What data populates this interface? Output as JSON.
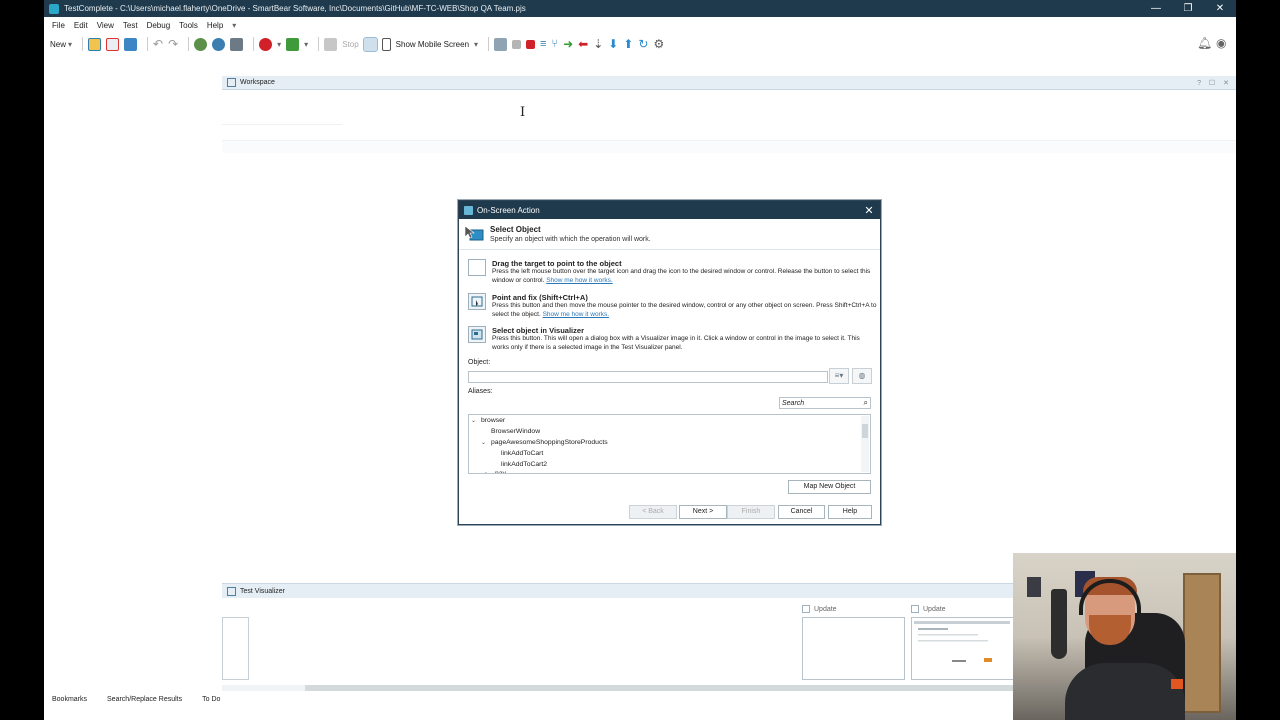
{
  "window": {
    "title": "TestComplete - C:\\Users\\michael.flaherty\\OneDrive - SmartBear Software, Inc\\Documents\\GitHub\\MF-TC-WEB\\Shop QA Team.pjs",
    "minimize": "—",
    "restore": "❐",
    "close": "✕"
  },
  "menu": [
    "File",
    "Edit",
    "View",
    "Test",
    "Debug",
    "Tools",
    "Help"
  ],
  "toolbar": {
    "new_label": "New",
    "stop_label": "Stop",
    "show_mobile_label": "Show Mobile Screen"
  },
  "workspace": {
    "title": "Workspace",
    "controls": "? ☐ ✕"
  },
  "dialog": {
    "title": "On-Screen Action",
    "close": "✕",
    "header_title": "Select Object",
    "header_subtitle": "Specify an object with which the operation will work.",
    "options": [
      {
        "title": "Drag the target to point to the object",
        "description": "Press the left mouse button over the target icon and drag the icon to the desired window or control. Release the button to select this window or control.",
        "link": "Show me how it works."
      },
      {
        "title": "Point and fix (Shift+Ctrl+A)",
        "description": "Press this button and then move the mouse pointer to the desired window, control or any other object on screen. Press Shift+Ctrl+A to select the object.",
        "link": "Show me how it works."
      },
      {
        "title": "Select object in Visualizer",
        "description": "Press this button. This will open a dialog box with a Visualizer image in it. Click a window or control in the image to select it. This works only if there is a selected image in the Test Visualizer panel.",
        "link": ""
      }
    ],
    "object_label": "Object:",
    "object_value": "",
    "aliases_label": "Aliases:",
    "search_placeholder": "Search",
    "tree": [
      {
        "label": "browser",
        "toggle": "⌄",
        "level": 0
      },
      {
        "label": "BrowserWindow",
        "toggle": "",
        "level": 1
      },
      {
        "label": "pageAwesomeShoppingStoreProducts",
        "toggle": "⌄",
        "level": 1
      },
      {
        "label": "linkAddToCart",
        "toggle": "",
        "level": 2
      },
      {
        "label": "linkAddToCart2",
        "toggle": "",
        "level": 2
      },
      {
        "label": "nav",
        "toggle": "›",
        "level": 2
      }
    ],
    "map_new_object": "Map New Object",
    "buttons": {
      "back": "< Back",
      "next": "Next >",
      "finish": "Finish",
      "cancel": "Cancel",
      "help": "Help"
    }
  },
  "test_visualizer": {
    "title": "Test Visualizer",
    "update_1": "Update",
    "update_2": "Update"
  },
  "bottom_tabs": [
    "Bookmarks",
    "Search/Replace Results",
    "To Do"
  ],
  "colors": {
    "title_bar": "#1f3a4d",
    "panel_header": "#e5eef4",
    "link": "#2b78b8"
  }
}
